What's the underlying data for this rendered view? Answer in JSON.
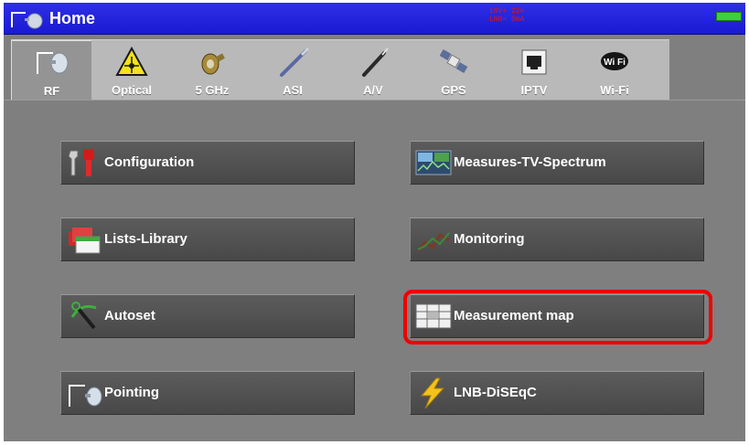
{
  "window": {
    "title": "Home",
    "status_line1": "18V+ 22k",
    "status_line2": "LNB= 0mA",
    "battery_color": "#3fcf3f",
    "accent_color": "#1a1ad2"
  },
  "tabs": [
    {
      "label": "RF",
      "icon": "antenna-icon",
      "active": true
    },
    {
      "label": "Optical",
      "icon": "laser-warning-icon",
      "active": false
    },
    {
      "label": "5 GHz",
      "icon": "connector-icon",
      "active": false
    },
    {
      "label": "ASI",
      "icon": "asi-cable-icon",
      "active": false
    },
    {
      "label": "A/V",
      "icon": "av-cable-icon",
      "active": false
    },
    {
      "label": "GPS",
      "icon": "satellite-icon",
      "active": false
    },
    {
      "label": "IPTV",
      "icon": "ethernet-port-icon",
      "active": false
    },
    {
      "label": "Wi-Fi",
      "icon": "wifi-icon",
      "active": false
    }
  ],
  "menu": {
    "configuration": "Configuration",
    "measures_tv_spectrum": "Measures-TV-Spectrum",
    "lists_library": "Lists-Library",
    "monitoring": "Monitoring",
    "autoset": "Autoset",
    "measurement_map": "Measurement map",
    "pointing": "Pointing",
    "lnb_diseqc": "LNB-DiSEqC"
  },
  "highlight": {
    "target": "measurement map",
    "color": "#ee0000"
  }
}
